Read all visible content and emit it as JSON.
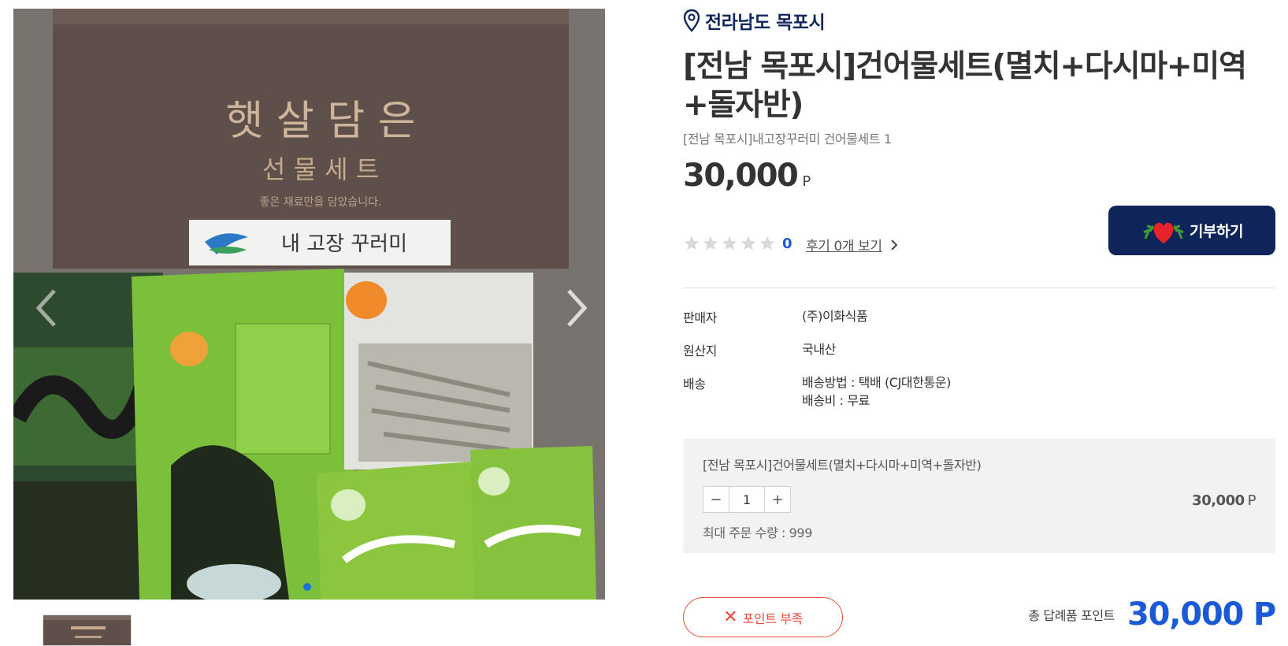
{
  "location": {
    "label": "전라남도 목포시"
  },
  "product": {
    "title": "[전남 목포시]건어물세트(멸치+다시마+미역+돌자반)",
    "subtitle": "[전남 목포시]내고장꾸러미 건어물세트 1",
    "price": "30,000",
    "price_unit": "P"
  },
  "rating": {
    "stars": 0,
    "count": "0",
    "review_link": "후기 0개 보기"
  },
  "donate_button": {
    "label": "기부하기"
  },
  "specs": [
    {
      "label": "판매자",
      "value": "(주)이화식품"
    },
    {
      "label": "원산지",
      "value": "국내산"
    },
    {
      "label": "배송",
      "value": "배송방법 : 택배 (CJ대한통운)",
      "value2": "배송비 : 무료"
    }
  ],
  "option": {
    "name": "[전남 목포시]건어물세트(멸치+다시마+미역+돌자반)",
    "minus": "−",
    "plus": "+",
    "quantity": "1",
    "price": "30,000",
    "unit": "P",
    "max_order": "최대 주문 수량 : 999"
  },
  "point_button": {
    "icon": "✕",
    "label": "포인트 부족"
  },
  "total": {
    "label": "총 답례품 포인트",
    "value": "30,000 P"
  },
  "gallery": {
    "box_text": {
      "line1": "햇 살 담 은",
      "line2": "선 물 세 트",
      "line3": "좋은 재료만을 담았습니다.",
      "brand": "내 고장 꾸러미"
    }
  },
  "colors": {
    "navy": "#0f2459",
    "blue": "#1b5ad6",
    "red": "#e84a3c"
  }
}
